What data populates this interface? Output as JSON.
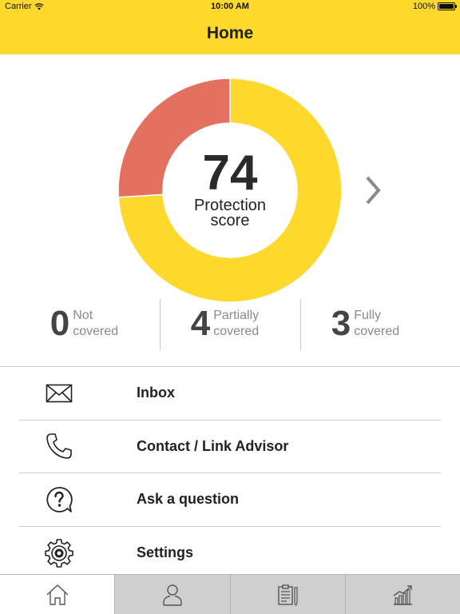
{
  "status_bar": {
    "carrier": "Carrier",
    "time": "10:00 AM",
    "battery": "100%",
    "battery_level": 1.0,
    "icons": [
      "wifi-icon",
      "battery-icon"
    ]
  },
  "navbar": {
    "title": "Home"
  },
  "protection": {
    "score": "74",
    "label": "Protection score",
    "segments": [
      {
        "name": "covered",
        "fraction": 0.74,
        "color": "#fdd92e"
      },
      {
        "name": "uncovered",
        "fraction": 0.26,
        "color": "#e4705f"
      }
    ],
    "next_icon": "chevron-right-icon"
  },
  "summary": [
    {
      "count": "0",
      "line1": "Not",
      "line2": "covered"
    },
    {
      "count": "4",
      "line1": "Partially",
      "line2": "covered"
    },
    {
      "count": "3",
      "line1": "Fully",
      "line2": "covered"
    }
  ],
  "menu": [
    {
      "label": "Inbox",
      "icon": "envelope-icon"
    },
    {
      "label": "Contact / Link Advisor",
      "icon": "phone-icon"
    },
    {
      "label": "Ask a question",
      "icon": "question-bubble-icon"
    },
    {
      "label": "Settings",
      "icon": "gear-icon"
    }
  ],
  "tabs": [
    {
      "icon": "home-icon",
      "active": true
    },
    {
      "icon": "person-icon",
      "active": false
    },
    {
      "icon": "clipboard-icon",
      "active": false
    },
    {
      "icon": "growth-chart-icon",
      "active": false
    }
  ],
  "colors": {
    "brand_yellow": "#fdd92e",
    "alert_red": "#e4705f",
    "tab_inactive": "#cfcfcf"
  }
}
